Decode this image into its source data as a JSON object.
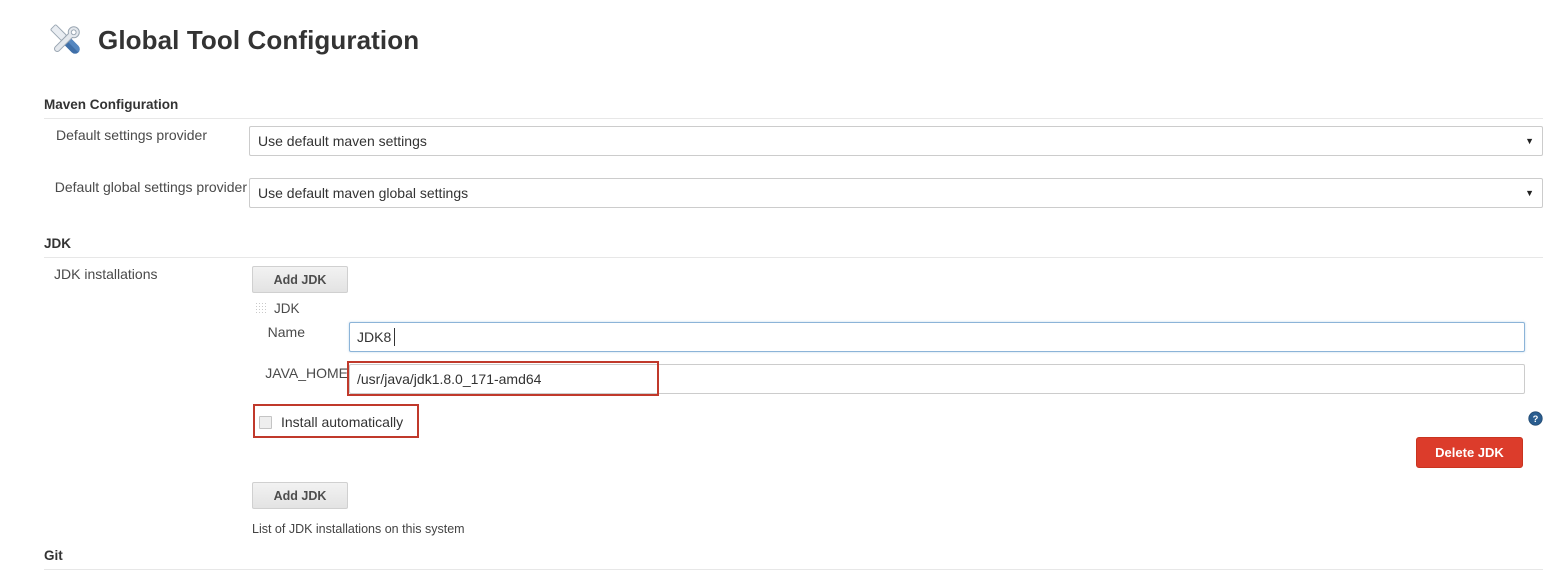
{
  "header": {
    "title": "Global Tool Configuration",
    "icon": "tools-wrench-screwdriver-icon"
  },
  "sections": {
    "maven": {
      "header": "Maven Configuration",
      "rows": [
        {
          "label": "Default settings provider",
          "value": "Use default maven settings",
          "caret": "▼"
        },
        {
          "label": "Default global settings provider",
          "value": "Use default maven global settings",
          "caret": "▼"
        }
      ]
    },
    "jdk": {
      "header": "JDK",
      "installations_label": "JDK installations",
      "add_button_top": "Add JDK",
      "entry_title": "JDK",
      "name_label": "Name",
      "name_value": "JDK8",
      "java_home_label": "JAVA_HOME",
      "java_home_value": "/usr/java/jdk1.8.0_171-amd64",
      "install_automatically_label": "Install automatically",
      "install_automatically_checked": false,
      "delete_button": "Delete JDK",
      "add_button_bottom": "Add JDK",
      "help_text": "List of JDK installations on this system"
    },
    "git": {
      "header": "Git"
    }
  },
  "colors": {
    "delete_button_bg": "#dc3c2b",
    "annotation_border": "#c0392b",
    "focus_border": "#8cb4d8",
    "help_icon": "#2a5d8f",
    "title_text": "#333333"
  },
  "icons": {
    "help": "help-circle-icon",
    "drag": "drag-handle-icon"
  }
}
